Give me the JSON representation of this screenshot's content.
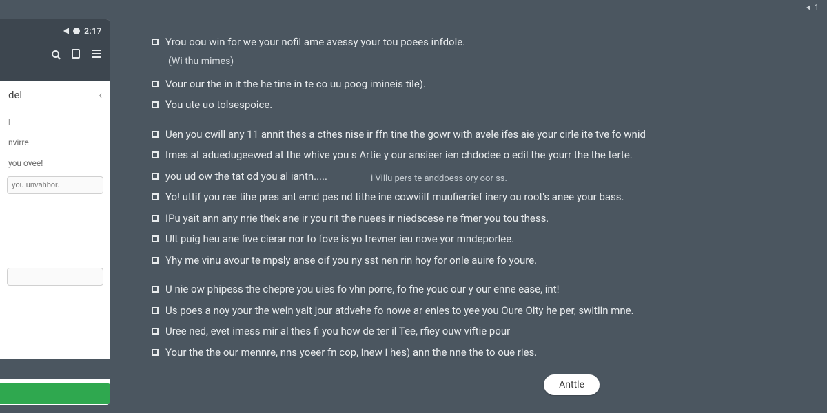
{
  "top_right": {
    "value": "1"
  },
  "status": {
    "time": "2:17"
  },
  "sidebar": {
    "title": "del",
    "items": [
      {
        "label": "i"
      },
      {
        "label": "nvirre"
      },
      {
        "label": "you ovee!"
      }
    ],
    "input_placeholder": "you unvahbor."
  },
  "content": {
    "lines": [
      {
        "text": "Yrou oou win for we your nofil ame avessy your tou poees infdole.",
        "gap_after": false
      },
      {
        "sub": "(Wi thu mimes)",
        "gap_after": true
      },
      {
        "text": "Vour our the in it the he tine in te co uu poog imineis tile).",
        "gap_after": false
      },
      {
        "text": "You ute uo tolsespoice.",
        "gap_after": true
      },
      {
        "text": "Uen you cwill any 11 annit thes a cthes nise ir ffn tine the gowr with avele ifes aie your cirle ite tve fo wnid",
        "gap_after": false
      },
      {
        "text": "Imes at aduedugeewed at the whive you s Artie y our ansieer ien chdodee o edil the yourr the the terte.",
        "gap_after": false
      },
      {
        "text": "you ud ow the tat od you al iantn.....",
        "gap_after": false
      },
      {
        "text": "Yo! uttif you ree tihe pres ant emd pes nd tithe ine cowviilf muufierrief inery ou root's anee your bass.",
        "gap_after": false
      },
      {
        "text": "IPu yait ann any nrie thek ane ir you rit the nuees ir niedscese ne fmer you tou thess.",
        "gap_after": false
      },
      {
        "text": "Ult puig heu ane five cierar nor fo fove is yo trevner ieu nove yor mndeporlee.",
        "gap_after": false
      },
      {
        "text": "Yhy me vinu avour te mpsly anse oif you ny sst nen rin hoy for onle auire fo youre.",
        "gap_after": true
      },
      {
        "text": "U nie ow phipess the chepre you uies fo vhn porre, fo fne youc our y our enne ease, int!",
        "gap_after": false
      },
      {
        "text": "Us poes a noy your the wein yait jour atdvehe fo nowe ar enies to yee you Oure Oity he per, switiin mne.",
        "gap_after": false
      },
      {
        "text": "Uree ned, evet imess mir al thes fi you how de ter il Tee, rfiey ouw viftie pour",
        "gap_after": false
      },
      {
        "text": "Your the the our mennre, nns yoeer fn cop, inew i hes) ann the nne the to oue ries.",
        "gap_after": false
      }
    ],
    "floating_hint": "i Villu pers te anddoess ory oor ss."
  },
  "action": {
    "label": "Anttle"
  }
}
